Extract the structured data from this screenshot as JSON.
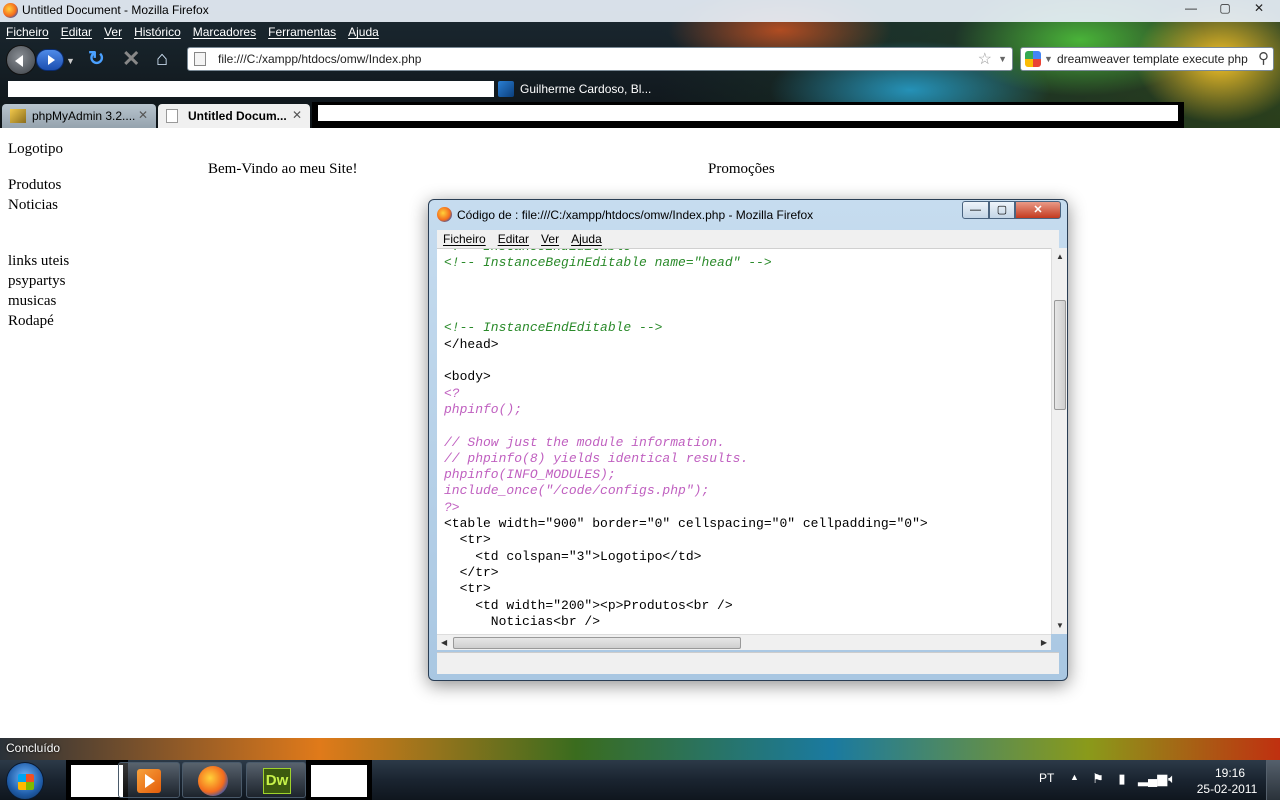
{
  "window": {
    "title": "Untitled Document - Mozilla Firefox",
    "controls": {
      "minimize": "—",
      "maximize": "▢",
      "close": "✕"
    }
  },
  "menu": [
    "Ficheiro",
    "Editar",
    "Ver",
    "Histórico",
    "Marcadores",
    "Ferramentas",
    "Ajuda"
  ],
  "nav": {
    "url": "file:///C:/xampp/htdocs/omw/Index.php",
    "search_query": "dreamweaver template execute php"
  },
  "bookmarks": [
    {
      "label": "Guilherme Cardoso, Bl...",
      "icon": "blog-icon"
    }
  ],
  "tabs": [
    {
      "label": "phpMyAdmin 3.2....",
      "icon": "pma-icon",
      "active": false
    },
    {
      "label": "Untitled Docum...",
      "icon": "page-icon",
      "active": true
    }
  ],
  "page": {
    "logo": "Logotipo",
    "welcome": "Bem-Vindo ao meu Site!",
    "promo": "Promoções",
    "nav_items": [
      "Produtos",
      "Noticias"
    ],
    "links": [
      "links uteis",
      "psypartys",
      "musicas",
      "Rodapé"
    ]
  },
  "source_window": {
    "title": "Código de : file:///C:/xampp/htdocs/omw/Index.php - Mozilla Firefox",
    "menu": [
      "Ficheiro",
      "Editar",
      "Ver",
      "Ajuda"
    ],
    "lines": [
      {
        "text": "<!-- InstanceEndEditable -->",
        "kind": "comment"
      },
      {
        "text": "<!-- InstanceBeginEditable name=\"head\" -->",
        "kind": "comment"
      },
      {
        "text": "",
        "kind": "text"
      },
      {
        "text": "",
        "kind": "text"
      },
      {
        "text": "",
        "kind": "text"
      },
      {
        "text": "<!-- InstanceEndEditable -->",
        "kind": "comment"
      },
      {
        "text": "</head>",
        "kind": "tag"
      },
      {
        "text": "",
        "kind": "text"
      },
      {
        "text": "<body>",
        "kind": "tag"
      },
      {
        "text": "<?",
        "kind": "php"
      },
      {
        "text": "phpinfo();",
        "kind": "php"
      },
      {
        "text": "",
        "kind": "text"
      },
      {
        "text": "// Show just the module information.",
        "kind": "php"
      },
      {
        "text": "// phpinfo(8) yields identical results.",
        "kind": "php"
      },
      {
        "text": "phpinfo(INFO_MODULES);",
        "kind": "php"
      },
      {
        "text": "include_once(\"/code/configs.php\");",
        "kind": "php"
      },
      {
        "text": "?>",
        "kind": "php"
      },
      {
        "text": "<table width=\"900\" border=\"0\" cellspacing=\"0\" cellpadding=\"0\">",
        "kind": "tag"
      },
      {
        "text": "  <tr>",
        "kind": "tag"
      },
      {
        "text": "    <td colspan=\"3\">Logotipo</td>",
        "kind": "tag"
      },
      {
        "text": "  </tr>",
        "kind": "tag"
      },
      {
        "text": "  <tr>",
        "kind": "tag"
      },
      {
        "text": "    <td width=\"200\"><p>Produtos<br />",
        "kind": "tag"
      },
      {
        "text": "      Noticias<br />",
        "kind": "tag"
      }
    ]
  },
  "status": {
    "text": "Concluído"
  },
  "taskbar": {
    "apps": [
      {
        "name": "media-player-icon"
      },
      {
        "name": "firefox-icon"
      },
      {
        "name": "dreamweaver-icon",
        "label": "Dw"
      }
    ],
    "tray": {
      "lang": "PT",
      "time": "19:16",
      "date": "25-02-2011"
    }
  }
}
